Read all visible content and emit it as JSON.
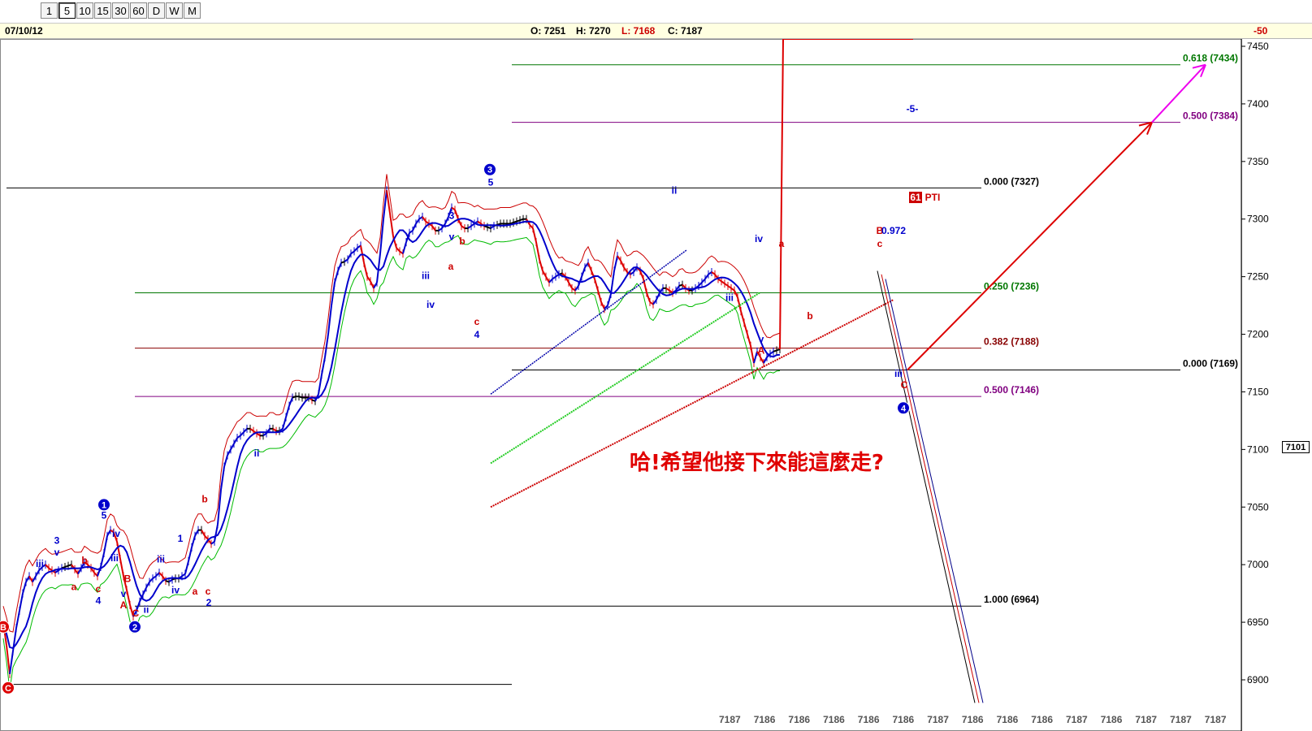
{
  "toolbar": {
    "timeframes": [
      "1",
      "5",
      "10",
      "15",
      "30",
      "60",
      "D",
      "W",
      "M"
    ],
    "active": "5"
  },
  "info_bar": {
    "date": "07/10/12",
    "open": "O: 7251",
    "high": "H: 7270",
    "low": "L: 7168",
    "close": "C: 7187",
    "change": "-50"
  },
  "annotation": {
    "text": "哈!希望他接下來能這麼走?",
    "color": "#e00000"
  },
  "colors": {
    "price_up": "#0000cc",
    "price_down": "#dd0000",
    "price_flat": "#000000",
    "ma": "#0000cc",
    "upper_band": "#cc0000",
    "lower_band": "#00bb00",
    "fib_green": "#007700",
    "fib_purple": "#800080",
    "fib_red": "#880000",
    "fib_black": "#000000",
    "projection": "#dd0000",
    "projection_ext": "#ee00ee"
  },
  "chart_data": {
    "type": "line",
    "title": "",
    "xlabel": "",
    "ylabel": "",
    "ylim": [
      6880,
      7460
    ],
    "y_ticks": [
      6900,
      6950,
      7000,
      7050,
      7100,
      7150,
      7200,
      7250,
      7300,
      7350,
      7400,
      7450
    ],
    "last_price_tag": "7101",
    "bottom_labels": [
      "7187",
      "7186",
      "7186",
      "7186",
      "7186",
      "7186",
      "7187",
      "7186",
      "7186",
      "7186",
      "7187",
      "7186",
      "7187",
      "7187",
      "7187"
    ],
    "series": [
      {
        "name": "",
        "x": [
          0,
          4,
          8,
          12,
          16,
          20,
          24,
          28,
          32,
          36,
          40,
          44,
          48,
          52,
          56,
          60,
          64,
          68,
          72,
          76,
          80,
          84,
          88,
          92,
          96,
          100,
          104,
          108,
          112,
          116,
          120,
          124,
          128,
          132,
          136,
          140,
          144,
          148,
          152,
          156,
          160,
          164,
          168,
          172,
          176,
          180,
          184,
          188,
          192,
          196,
          200,
          204,
          208,
          212,
          216,
          220,
          224,
          228,
          232,
          236,
          240,
          244,
          248,
          252,
          256,
          260,
          264,
          268,
          272,
          276,
          280,
          284,
          288,
          292,
          296,
          300,
          304,
          308,
          312,
          316,
          320,
          324,
          328,
          332,
          336,
          340,
          344,
          348,
          352,
          356,
          360,
          364,
          368,
          372,
          376,
          380,
          384,
          388,
          392,
          396,
          400,
          404,
          408,
          412,
          416,
          420,
          424,
          428,
          432,
          436,
          440,
          444,
          448,
          452,
          456,
          460,
          464,
          468,
          472,
          476,
          480,
          484,
          488,
          492,
          496,
          500,
          504,
          508,
          512,
          516,
          520,
          524,
          528,
          532,
          536,
          540,
          544,
          548,
          552,
          556,
          560,
          564,
          568,
          572,
          576,
          580,
          584,
          588,
          592,
          596,
          600,
          604,
          608,
          612,
          616,
          620,
          624,
          628,
          632,
          636,
          640,
          644,
          648,
          652,
          656,
          660,
          664,
          668,
          672,
          676,
          680,
          684,
          688,
          692,
          696,
          700,
          704,
          708,
          712,
          716,
          720,
          724,
          728,
          732,
          736,
          740,
          744,
          748,
          752,
          756,
          760,
          764,
          768,
          772,
          776,
          780,
          784,
          788,
          792,
          796,
          800,
          804,
          808,
          812,
          816,
          820,
          824,
          828,
          832,
          836,
          840,
          844,
          848,
          852,
          856,
          860,
          864,
          868,
          872,
          876,
          880,
          884,
          888,
          892,
          896,
          900,
          904,
          908,
          912,
          916,
          920,
          924,
          928,
          932,
          936,
          940,
          944,
          948,
          952,
          956,
          960,
          964,
          968,
          972,
          976,
          980,
          984,
          988,
          992,
          996,
          1000,
          1004,
          1008,
          1012,
          1016,
          1020,
          1024,
          1028,
          1032,
          1036,
          1040,
          1044,
          1048,
          1052,
          1056,
          1060,
          1064,
          1068,
          1072,
          1076,
          1080,
          1084,
          1088,
          1092,
          1096,
          1100,
          1104,
          1108,
          1112,
          1116,
          1120
        ],
        "close": [
          6950,
          6930,
          6905,
          6925,
          6945,
          6960,
          6975,
          6985,
          6990,
          6985,
          6990,
          6995,
          6998,
          7000,
          6997,
          6995,
          6993,
          6995,
          6997,
          6998,
          6999,
          7000,
          6996,
          6992,
          6997,
          7002,
          7000,
          6997,
          6993,
          6990,
          6998,
          7010,
          7025,
          7030,
          7028,
          7020,
          7005,
          6990,
          6978,
          6965,
          6955,
          6960,
          6968,
          6974,
          6980,
          6985,
          6988,
          6990,
          6993,
          6990,
          6986,
          6985,
          6987,
          6988,
          6988,
          6990,
          6992,
          7003,
          7015,
          7025,
          7030,
          7030,
          7025,
          7022,
          7018,
          7020,
          7035,
          7065,
          7085,
          7095,
          7100,
          7105,
          7110,
          7112,
          7115,
          7118,
          7118,
          7116,
          7114,
          7112,
          7112,
          7114,
          7118,
          7118,
          7116,
          7116,
          7118,
          7128,
          7138,
          7145,
          7146,
          7146,
          7145,
          7145,
          7145,
          7143,
          7142,
          7148,
          7165,
          7180,
          7200,
          7225,
          7245,
          7255,
          7262,
          7263,
          7265,
          7270,
          7272,
          7275,
          7277,
          7262,
          7250,
          7246,
          7240,
          7245,
          7270,
          7300,
          7325,
          7305,
          7285,
          7275,
          7272,
          7270,
          7280,
          7288,
          7290,
          7296,
          7300,
          7302,
          7298,
          7296,
          7294,
          7290,
          7290,
          7292,
          7296,
          7302,
          7310,
          7308,
          7300,
          7294,
          7292,
          7292,
          7294,
          7296,
          7298,
          7296,
          7294,
          7293,
          7292,
          7294,
          7295,
          7296,
          7296,
          7296,
          7296,
          7297,
          7298,
          7299,
          7300,
          7300,
          7295,
          7292,
          7280,
          7265,
          7255,
          7250,
          7245,
          7248,
          7250,
          7252,
          7253,
          7250,
          7245,
          7240,
          7238,
          7242,
          7250,
          7258,
          7262,
          7255,
          7248,
          7238,
          7228,
          7222,
          7225,
          7235,
          7255,
          7268,
          7264,
          7258,
          7254,
          7252,
          7254,
          7258,
          7255,
          7248,
          7236,
          7228,
          7226,
          7230,
          7236,
          7240,
          7240,
          7238,
          7236,
          7238,
          7242,
          7243,
          7240,
          7238,
          7238,
          7240,
          7242,
          7245,
          7248,
          7252,
          7254,
          7252,
          7248,
          7246,
          7244,
          7242,
          7240,
          7238,
          7232,
          7220,
          7210,
          7200,
          7190,
          7175,
          7185,
          7180,
          7175,
          7180,
          7183,
          7185,
          7186,
          7187
        ]
      }
    ],
    "fib_levels": [
      {
        "label": "0.618 (7434)",
        "price": 7434,
        "color": "#007700"
      },
      {
        "label": "0.500 (7384)",
        "price": 7384,
        "color": "#800080"
      },
      {
        "label": "0.000 (7327)",
        "price": 7327,
        "color": "#000000"
      },
      {
        "label": "0.250 (7236)",
        "price": 7236,
        "color": "#007700"
      },
      {
        "label": "0.382 (7188)",
        "price": 7188,
        "color": "#880000"
      },
      {
        "label": "0.000 (7169)",
        "price": 7169,
        "color": "#000000"
      },
      {
        "label": "0.500 (7146)",
        "price": 7146,
        "color": "#800080"
      },
      {
        "label": "1.000 (6964)",
        "price": 6964,
        "color": "#000000"
      }
    ],
    "wave_markers": [
      {
        "label": "1",
        "style": "circle-blue",
        "x": 128,
        "price": 7052
      },
      {
        "label": "2",
        "style": "circle-blue",
        "x": 166,
        "price": 6946
      },
      {
        "label": "3",
        "style": "circle-blue",
        "x": 603,
        "price": 7343
      },
      {
        "label": "4",
        "style": "circle-blue",
        "x": 1112,
        "price": 7136
      },
      {
        "label": "B",
        "style": "circle-red",
        "x": 4,
        "price": 6946
      },
      {
        "label": "C",
        "style": "circle-red",
        "x": 10,
        "price": 6893
      }
    ],
    "wave_labels": [
      {
        "text": "3",
        "color": "#0000cc",
        "x": 70,
        "price": 7018
      },
      {
        "text": "v",
        "color": "#0000cc",
        "x": 70,
        "price": 7008
      },
      {
        "text": "iii",
        "color": "#0000cc",
        "x": 49,
        "price": 6998
      },
      {
        "text": "b",
        "color": "#cc0000",
        "x": 104,
        "price": 7001
      },
      {
        "text": "a",
        "color": "#cc0000",
        "x": 91,
        "price": 6978
      },
      {
        "text": "c",
        "color": "#cc0000",
        "x": 121,
        "price": 6976
      },
      {
        "text": "4",
        "color": "#0000cc",
        "x": 121,
        "price": 6966
      },
      {
        "text": "5",
        "color": "#0000cc",
        "x": 128,
        "price": 7040
      },
      {
        "text": "iv",
        "color": "#0000cc",
        "x": 143,
        "price": 7024
      },
      {
        "text": "iii",
        "color": "#0000cc",
        "x": 141,
        "price": 7003
      },
      {
        "text": "B",
        "color": "#cc0000",
        "x": 157,
        "price": 6985
      },
      {
        "text": "v",
        "color": "#0000cc",
        "x": 152,
        "price": 6972
      },
      {
        "text": "A",
        "color": "#cc0000",
        "x": 152,
        "price": 6962
      },
      {
        "text": "C",
        "color": "#cc0000",
        "x": 167,
        "price": 6955
      },
      {
        "text": "ii",
        "color": "#0000cc",
        "x": 180,
        "price": 6958
      },
      {
        "text": "iii",
        "color": "#0000cc",
        "x": 198,
        "price": 7002
      },
      {
        "text": "iv",
        "color": "#0000cc",
        "x": 216,
        "price": 6975
      },
      {
        "text": "1",
        "color": "#0000cc",
        "x": 222,
        "price": 7020
      },
      {
        "text": "a",
        "color": "#cc0000",
        "x": 240,
        "price": 6974
      },
      {
        "text": "b",
        "color": "#cc0000",
        "x": 252,
        "price": 7054
      },
      {
        "text": "c",
        "color": "#cc0000",
        "x": 256,
        "price": 6974
      },
      {
        "text": "2",
        "color": "#0000cc",
        "x": 257,
        "price": 6964
      },
      {
        "text": "ii",
        "color": "#0000cc",
        "x": 316,
        "price": 7094
      },
      {
        "text": "iii",
        "color": "#0000cc",
        "x": 524,
        "price": 7248
      },
      {
        "text": "iv",
        "color": "#0000cc",
        "x": 530,
        "price": 7223
      },
      {
        "text": "3",
        "color": "#0000cc",
        "x": 556,
        "price": 7300
      },
      {
        "text": "v",
        "color": "#0000cc",
        "x": 556,
        "price": 7282
      },
      {
        "text": "b",
        "color": "#cc0000",
        "x": 569,
        "price": 7278
      },
      {
        "text": "a",
        "color": "#cc0000",
        "x": 555,
        "price": 7256
      },
      {
        "text": "c",
        "color": "#cc0000",
        "x": 587,
        "price": 7208
      },
      {
        "text": "4",
        "color": "#0000cc",
        "x": 587,
        "price": 7197
      },
      {
        "text": "5",
        "color": "#0000cc",
        "x": 604,
        "price": 7329
      },
      {
        "text": "ii",
        "color": "#0000cc",
        "x": 830,
        "price": 7322
      },
      {
        "text": "iv",
        "color": "#0000cc",
        "x": 934,
        "price": 7280
      },
      {
        "text": "a",
        "color": "#cc0000",
        "x": 962,
        "price": 7276
      },
      {
        "text": "iii",
        "color": "#0000cc",
        "x": 898,
        "price": 7229
      },
      {
        "text": "v",
        "color": "#0000cc",
        "x": 937,
        "price": 7193
      },
      {
        "text": "A",
        "color": "#cc0000",
        "x": 937,
        "price": 7183
      },
      {
        "text": "b",
        "color": "#cc0000",
        "x": 997,
        "price": 7213
      },
      {
        "text": "B",
        "color": "#cc0000",
        "x": 1083,
        "price": 7287
      },
      {
        "text": "c",
        "color": "#cc0000",
        "x": 1083,
        "price": 7276
      },
      {
        "text": "iii",
        "color": "#0000cc",
        "x": 1106,
        "price": 7163
      },
      {
        "text": "C",
        "color": "#cc0000",
        "x": 1113,
        "price": 7153
      }
    ],
    "extra_labels": [
      {
        "text": "0.972",
        "color": "#0000cc",
        "x": 1100,
        "price": 7287
      },
      {
        "text": "-5-",
        "color": "#0000cc",
        "x": 1123,
        "price": 7393
      },
      {
        "text": "PTI",
        "color": "#cc0000",
        "x": 1148,
        "price": 7316
      },
      {
        "text": "61",
        "color": "#ffffff",
        "x": 1127,
        "price": 7316
      }
    ]
  }
}
